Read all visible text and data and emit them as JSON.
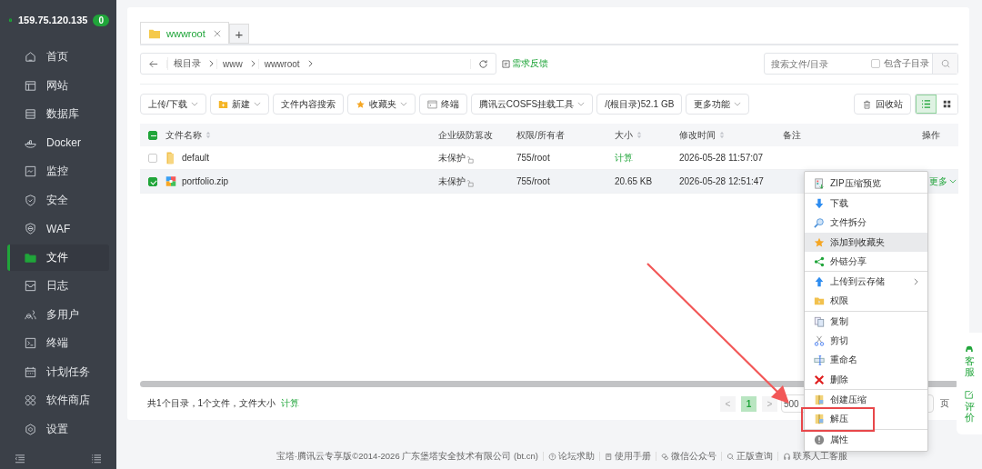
{
  "sidebar": {
    "server": "159.75.120.135",
    "badge": "0",
    "items": [
      {
        "label": "首页",
        "kind": "home",
        "selected": false
      },
      {
        "label": "网站",
        "kind": "site",
        "selected": false
      },
      {
        "label": "数据库",
        "kind": "database",
        "selected": false
      },
      {
        "label": "Docker",
        "kind": "docker",
        "selected": false
      },
      {
        "label": "监控",
        "kind": "monitor",
        "selected": false
      },
      {
        "label": "安全",
        "kind": "shield",
        "selected": false
      },
      {
        "label": "WAF",
        "kind": "waf",
        "selected": false
      },
      {
        "label": "文件",
        "kind": "folder",
        "selected": true
      },
      {
        "label": "日志",
        "kind": "log",
        "selected": false
      },
      {
        "label": "多用户",
        "kind": "users",
        "selected": false
      },
      {
        "label": "终端",
        "kind": "terminal",
        "selected": false
      },
      {
        "label": "计划任务",
        "kind": "calendar",
        "selected": false
      },
      {
        "label": "软件商店",
        "kind": "apps",
        "selected": false
      },
      {
        "label": "设置",
        "kind": "settings",
        "selected": false
      }
    ]
  },
  "tabs": [
    {
      "label": "wwwroot",
      "selected": true
    }
  ],
  "add_tab": "+",
  "breadcrumb": [
    "根目录",
    "www",
    "wwwroot"
  ],
  "feedback": "需求反馈",
  "search": {
    "placeholder": "搜索文件/目录",
    "subdir_label": "包含子目录",
    "subdir_checked": false
  },
  "toolbar": [
    {
      "label": "上传/下载",
      "kind": "plain",
      "dropdown": true
    },
    {
      "label": "新建",
      "kind": "new-folder",
      "dropdown": true
    },
    {
      "label": "文件内容搜索",
      "kind": "plain",
      "dropdown": false
    },
    {
      "label": "收藏夹",
      "kind": "star",
      "dropdown": true
    },
    {
      "label": "终端",
      "kind": "terminal",
      "dropdown": false
    },
    {
      "label": "腾讯云COSFS挂载工具",
      "kind": "plain",
      "dropdown": true
    },
    {
      "label": "/(根目录)52.1 GB",
      "kind": "plain",
      "dropdown": false
    },
    {
      "label": "更多功能",
      "kind": "plain",
      "dropdown": true
    }
  ],
  "recycle": "回收站",
  "views": [
    {
      "kind": "list",
      "selected": true
    },
    {
      "kind": "grid",
      "selected": false
    }
  ],
  "table": {
    "indeterminate": true,
    "columns": [
      {
        "label": "文件名称",
        "sortable": true
      },
      {
        "label": "企业级防篡改",
        "sortable": false
      },
      {
        "label": "权限/所有者",
        "sortable": false
      },
      {
        "label": "大小",
        "sortable": true
      },
      {
        "label": "修改时间",
        "sortable": true
      },
      {
        "label": "备注",
        "sortable": false
      },
      {
        "label": "操作",
        "sortable": false
      }
    ],
    "rows": [
      {
        "name": "default",
        "kind": "folder",
        "checked": false,
        "protection": "未保护",
        "perm": "755/root",
        "size": {
          "kind": "link",
          "text": "计算"
        },
        "time": "2026-05-28 11:57:07"
      },
      {
        "name": "portfolio.zip",
        "kind": "zip",
        "checked": true,
        "protection": "未保护",
        "perm": "755/root",
        "size": {
          "kind": "text",
          "text": "20.65 KB"
        },
        "time": "2026-05-28 12:51:47",
        "action": "更多"
      }
    ]
  },
  "summary": {
    "text": "共1个目录，1个文件，文件大小",
    "link": "计算"
  },
  "pagination": {
    "prev": "<",
    "pages": [
      {
        "label": "1",
        "selected": true
      }
    ],
    "next": ">",
    "size": "500",
    "suffix": "页"
  },
  "footer": {
    "copyright": "宝塔·腾讯云专享版©2014-2026 广东堡塔安全技术有限公司 (bt.cn)",
    "links": [
      {
        "label": "论坛求助",
        "kind": "help"
      },
      {
        "label": "使用手册",
        "kind": "book"
      },
      {
        "label": "微信公众号",
        "kind": "wechat"
      },
      {
        "label": "正版查询",
        "kind": "search"
      },
      {
        "label": "联系人工客服",
        "kind": "service"
      }
    ]
  },
  "float_widget": [
    {
      "label": "客服",
      "kind": "headset"
    },
    {
      "label": "评价",
      "kind": "edit"
    }
  ],
  "context_menu": [
    {
      "label": "ZIP压缩预览",
      "kind": "zip-preview",
      "divider_before": false,
      "hovered": false,
      "submenu": false,
      "highlighted": false
    },
    {
      "label": "下载",
      "kind": "download",
      "divider_before": true,
      "hovered": false,
      "submenu": false,
      "highlighted": false
    },
    {
      "label": "文件拆分",
      "kind": "split",
      "divider_before": false,
      "hovered": false,
      "submenu": false,
      "highlighted": false
    },
    {
      "label": "添加到收藏夹",
      "kind": "star",
      "divider_before": false,
      "hovered": true,
      "submenu": false,
      "highlighted": false
    },
    {
      "label": "外链分享",
      "kind": "share",
      "divider_before": false,
      "hovered": false,
      "submenu": false,
      "highlighted": false
    },
    {
      "label": "上传到云存储",
      "kind": "upload",
      "divider_before": true,
      "hovered": false,
      "submenu": true,
      "highlighted": false
    },
    {
      "label": "权限",
      "kind": "permission",
      "divider_before": false,
      "hovered": false,
      "submenu": false,
      "highlighted": false
    },
    {
      "label": "复制",
      "kind": "copy",
      "divider_before": true,
      "hovered": false,
      "submenu": false,
      "highlighted": false
    },
    {
      "label": "剪切",
      "kind": "cut",
      "divider_before": false,
      "hovered": false,
      "submenu": false,
      "highlighted": false
    },
    {
      "label": "重命名",
      "kind": "rename",
      "divider_before": false,
      "hovered": false,
      "submenu": false,
      "highlighted": false
    },
    {
      "label": "删除",
      "kind": "delete",
      "divider_before": false,
      "hovered": false,
      "submenu": false,
      "highlighted": false
    },
    {
      "label": "创建压缩",
      "kind": "compress",
      "divider_before": true,
      "hovered": false,
      "submenu": false,
      "highlighted": false
    },
    {
      "label": "解压",
      "kind": "compress",
      "divider_before": false,
      "hovered": false,
      "submenu": false,
      "highlighted": true
    },
    {
      "label": "属性",
      "kind": "info",
      "divider_before": true,
      "hovered": false,
      "submenu": false,
      "highlighted": false
    }
  ]
}
